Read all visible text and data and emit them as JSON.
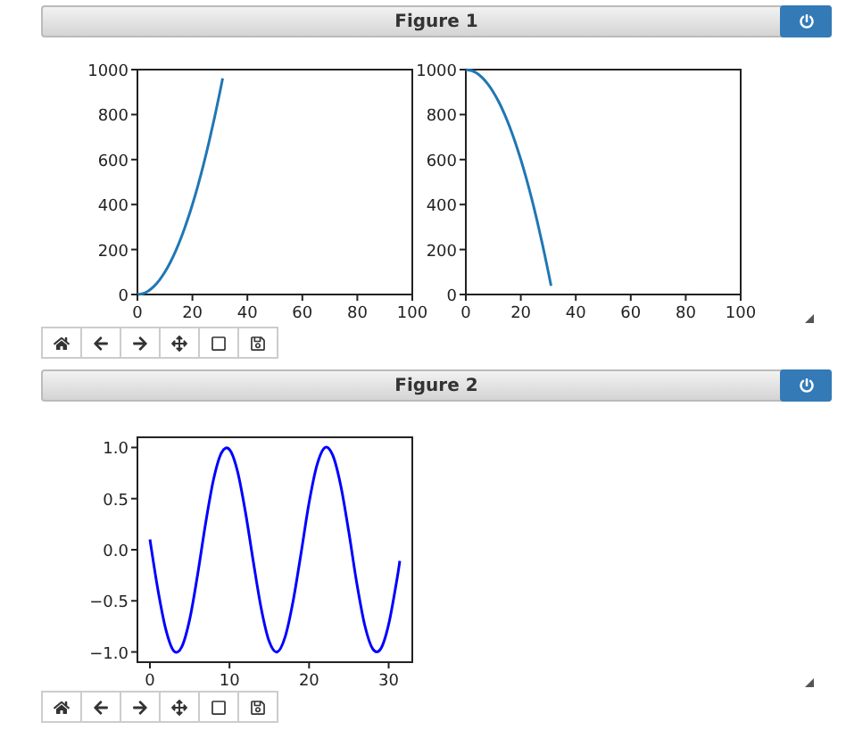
{
  "figures": [
    {
      "title": "Figure 1",
      "axes": [
        {
          "chart_data": {
            "type": "line",
            "x": [
              0,
              2,
              4,
              6,
              8,
              10,
              12,
              14,
              16,
              18,
              20,
              22,
              24,
              26,
              28,
              30,
              31
            ],
            "series": [
              {
                "color": "#1f77b4",
                "values": [
                  0,
                  4,
                  16,
                  36,
                  64,
                  100,
                  144,
                  196,
                  256,
                  324,
                  400,
                  484,
                  576,
                  676,
                  784,
                  900,
                  961
                ]
              }
            ],
            "xlim": [
              0,
              100
            ],
            "ylim": [
              0,
              1000
            ],
            "xticks": [
              0,
              20,
              40,
              60,
              80,
              100
            ],
            "yticks": [
              0,
              200,
              400,
              600,
              800,
              1000
            ]
          }
        },
        {
          "chart_data": {
            "type": "line",
            "x": [
              0,
              2,
              4,
              6,
              8,
              10,
              12,
              14,
              16,
              18,
              20,
              22,
              24,
              26,
              28,
              30,
              31
            ],
            "series": [
              {
                "color": "#1f77b4",
                "values": [
                  1000,
                  996,
                  984,
                  964,
                  936,
                  900,
                  856,
                  804,
                  744,
                  676,
                  600,
                  516,
                  424,
                  324,
                  216,
                  100,
                  39
                ]
              }
            ],
            "xlim": [
              0,
              100
            ],
            "ylim": [
              0,
              1000
            ],
            "xticks": [
              0,
              20,
              40,
              60,
              80,
              100
            ],
            "yticks": [
              0,
              200,
              400,
              600,
              800,
              1000
            ]
          }
        }
      ],
      "toolbar": [
        {
          "kind": "home"
        },
        {
          "kind": "back"
        },
        {
          "kind": "forward"
        },
        {
          "kind": "pan"
        },
        {
          "kind": "zoom"
        },
        {
          "kind": "save"
        }
      ]
    },
    {
      "title": "Figure 2",
      "axes": [
        {
          "chart_data": {
            "type": "line",
            "x": [
              0,
              1,
              2,
              3,
              4,
              5,
              6,
              7,
              8,
              9,
              10,
              11,
              12,
              13,
              14,
              15,
              16,
              17,
              18,
              19,
              20,
              21,
              22,
              23,
              24,
              25,
              26,
              27,
              28,
              29,
              30,
              31,
              31.4
            ],
            "series": [
              {
                "color": "#0000ff",
                "values": [
                  0.1,
                  -0.39,
                  -0.78,
                  -0.99,
                  -0.95,
                  -0.68,
                  -0.24,
                  0.26,
                  0.69,
                  0.95,
                  0.98,
                  0.77,
                  0.37,
                  -0.12,
                  -0.58,
                  -0.9,
                  -1,
                  -0.85,
                  -0.5,
                  -0.03,
                  0.46,
                  0.83,
                  1,
                  0.92,
                  0.62,
                  0.17,
                  -0.33,
                  -0.74,
                  -0.97,
                  -0.97,
                  -0.73,
                  -0.31,
                  -0.11
                ]
              }
            ],
            "xlim": [
              -1.57,
              32.97
            ],
            "ylim": [
              -1.1,
              1.1
            ],
            "xticks": [
              0,
              10,
              20,
              30
            ],
            "yticks": [
              {
                "value": -1,
                "label": "−1.0"
              },
              {
                "value": -0.5,
                "label": "−0.5"
              },
              {
                "value": 0,
                "label": "0.0"
              },
              {
                "value": 0.5,
                "label": "0.5"
              },
              {
                "value": 1,
                "label": "1.0"
              }
            ]
          }
        }
      ],
      "toolbar": [
        {
          "kind": "home"
        },
        {
          "kind": "back"
        },
        {
          "kind": "forward"
        },
        {
          "kind": "pan"
        },
        {
          "kind": "zoom"
        },
        {
          "kind": "save"
        }
      ]
    }
  ]
}
